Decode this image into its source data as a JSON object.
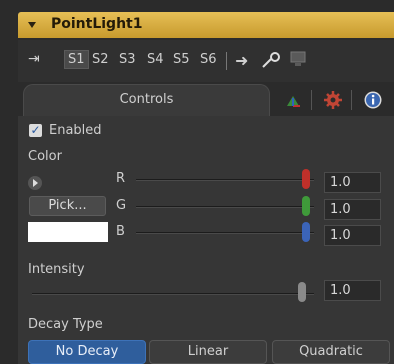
{
  "header": {
    "title": "PointLight1"
  },
  "toolbar": {
    "slots": [
      "S1",
      "S2",
      "S3",
      "S4",
      "S5",
      "S6"
    ],
    "active_slot": "S1",
    "icons": [
      "pin-icon",
      "arrow-right-icon",
      "lasso-icon",
      "monitor-icon"
    ]
  },
  "tabs": {
    "controls_label": "Controls",
    "icons": [
      "transform-tab-icon",
      "gear-tab-icon",
      "info-tab-icon"
    ]
  },
  "controls": {
    "enabled_label": "Enabled",
    "enabled": true,
    "color_label": "Color",
    "pick_label": "Pick...",
    "swatch_color": "#ffffff",
    "channels": [
      {
        "label": "R",
        "value": "1.0",
        "knob_color": "#c0302a"
      },
      {
        "label": "G",
        "value": "1.0",
        "knob_color": "#3f9a3a"
      },
      {
        "label": "B",
        "value": "1.0",
        "knob_color": "#3b64b8"
      }
    ],
    "intensity_label": "Intensity",
    "intensity_value": "1.0",
    "decay_label": "Decay Type",
    "decay_options": [
      "No Decay",
      "Linear",
      "Quadratic"
    ],
    "decay_selected": "No Decay"
  },
  "colors": {
    "title_bar": "#d9ad41",
    "selected_button": "#2f5e9c"
  }
}
